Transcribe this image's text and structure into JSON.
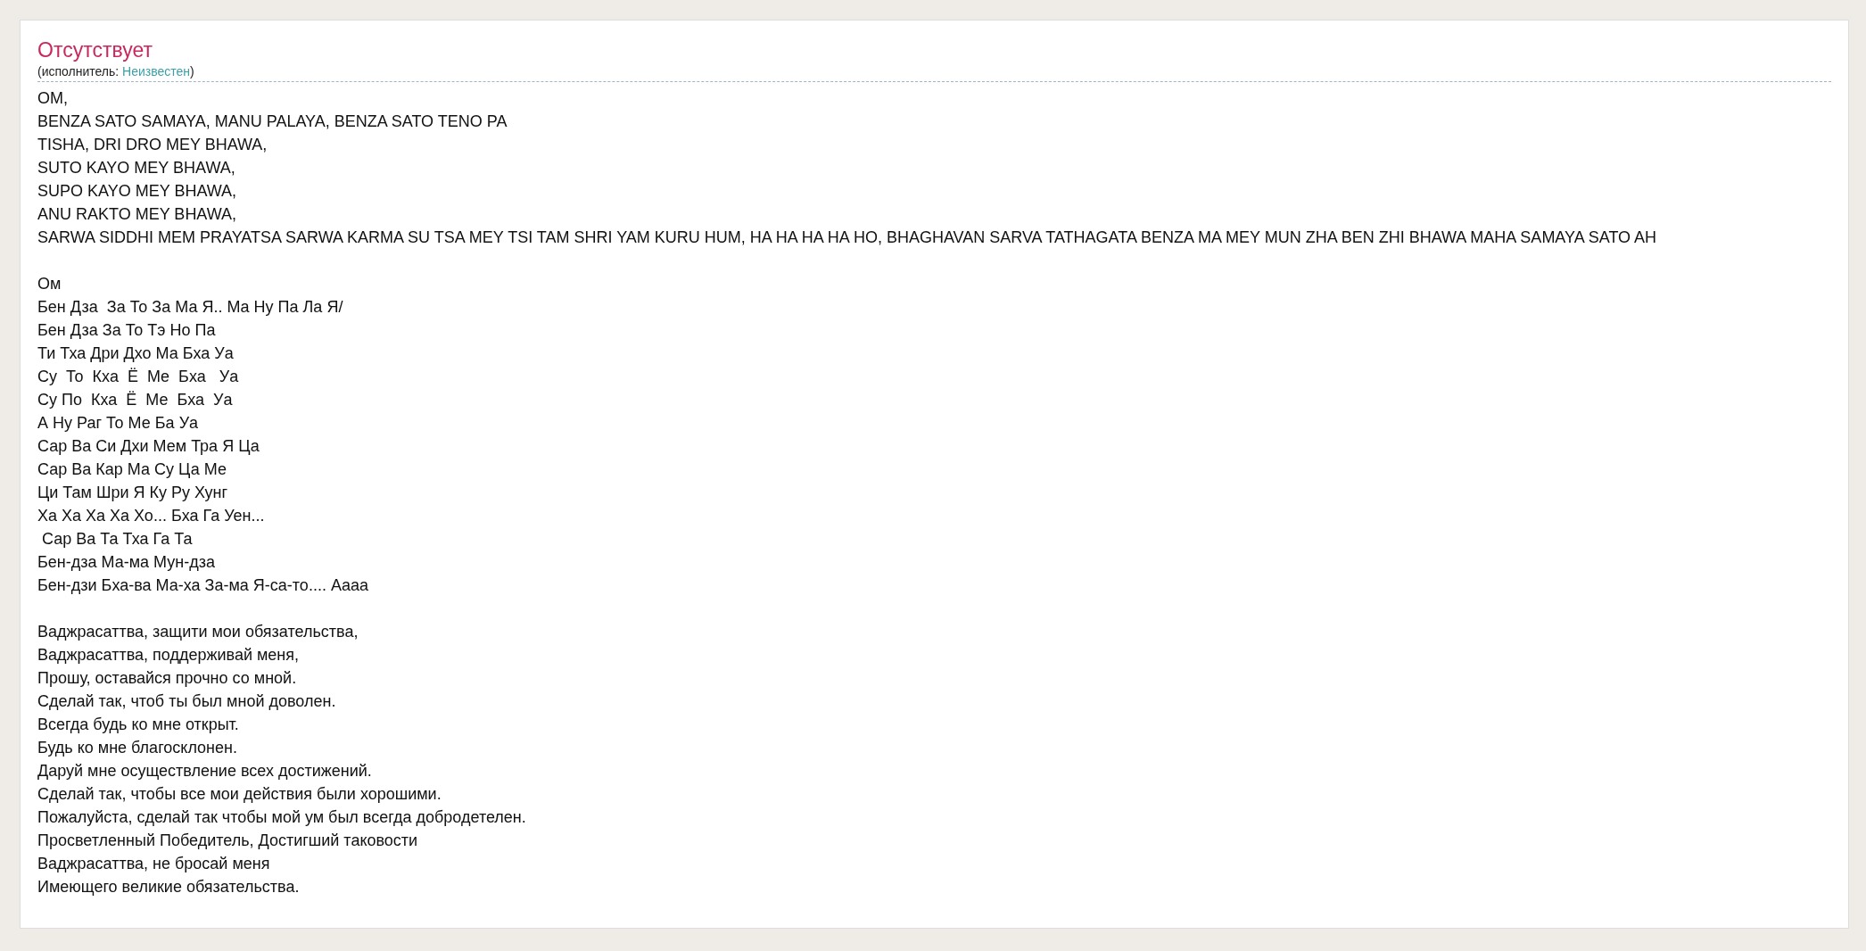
{
  "song": {
    "title": "Отсутствует",
    "credit": {
      "prefix": "(исполнитель:",
      "artist": "Неизвестен",
      "suffix": ")"
    }
  },
  "stanzas": [
    [
      "OM,",
      "BENZA SATO SAMAYA, MANU PALAYA, BENZA SATO TENO PA",
      "TISHA, DRI DRO MEY BHAWA,",
      "SUTO KAYO MEY BHAWA,",
      "SUPO KAYO MEY BHAWA,",
      "ANU RAKTO MEY BHAWA,",
      "SARWA SIDDHI MEM PRAYATSA SARWA KARMA SU TSA MEY TSI TAM SHRI YAM KURU HUM, HA HA HA HA HO, BHAGHAVAN SARVA TATHAGATA BENZA MA MEY MUN ZHA BEN ZHI BHAWA MAHA SAMAYA SATO AH"
    ],
    [
      "Ом",
      "Бен Дза  За То За Ма Я.. Ма Ну Па Ла Я/",
      "Бен Дза За То Тэ Но Па",
      "Ти Тха Дри Дхо Ма Бха Уа",
      "Су  То  Кха  Ё  Ме  Бха   Уа",
      "Су По  Кха  Ё  Ме  Бха  Уа",
      "А Ну Раг То Ме Ба Уа",
      "Сар Ва Си Дхи Мем Тра Я Ца",
      "Сар Ва Кар Ма Су Ца Ме",
      "Ци Там Шри Я Ку Ру Хунг",
      "Ха Ха Ха Ха Хо... Бха Га Уен...",
      " Сар Ва Та Тха Га Та",
      "Бен-дза Ма-ма Мун-дза",
      "Бен-дзи Бха-ва Ма-ха За-ма Я-са-то.... Аааа"
    ],
    [
      "Ваджрасаттва, защити мои обязательства,",
      "Ваджрасаттва, поддерживай меня,",
      "Прошу, оставайся прочно со мной.",
      "Сделай так, чтоб ты был мной доволен.",
      "Всегда будь ко мне открыт.",
      "Будь ко мне благосклонен.",
      "Даруй мне осуществление всех достижений.",
      "Сделай так, чтобы все мои действия были хорошими.",
      "Пожалуйста, сделай так чтобы мой ум был всегда добродетелен.",
      "Просветленный Победитель, Достигший таковости",
      "Ваджрасаттва, не бросай меня",
      "Имеющего великие обязательства."
    ]
  ]
}
